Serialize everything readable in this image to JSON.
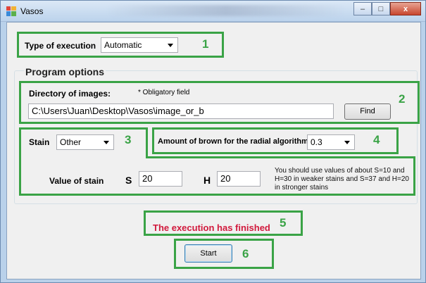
{
  "window": {
    "title": "Vasos",
    "controls": {
      "minimize": "–",
      "maximize": "□",
      "close": "x"
    }
  },
  "execution": {
    "label": "Type of execution",
    "value": "Automatic",
    "marker": "1"
  },
  "program_options": {
    "title": "Program options",
    "directory": {
      "label": "Directory of images:",
      "note": "* Obligatory field",
      "value": "C:\\Users\\Juan\\Desktop\\Vasos\\image_or_b",
      "find_label": "Find",
      "marker": "2"
    },
    "stain": {
      "label": "Stain",
      "value": "Other",
      "marker": "3"
    },
    "brown": {
      "label": "Amount of brown for the radial algorithm",
      "value": "0.3",
      "marker": "4"
    },
    "stain_values": {
      "label": "Value of stain",
      "s_label": "S",
      "s_value": "20",
      "h_label": "H",
      "h_value": "20",
      "hint": "You should use values of about S=10 and H=30 in weaker stains and S=37 and H=20 in stronger stains"
    }
  },
  "status": {
    "text": "The execution has finished",
    "marker": "5"
  },
  "start": {
    "label": "Start",
    "marker": "6"
  },
  "colors": {
    "annotation": "#3aa346",
    "status_text": "#d1193c",
    "window_frame": "#b9d1ea"
  }
}
